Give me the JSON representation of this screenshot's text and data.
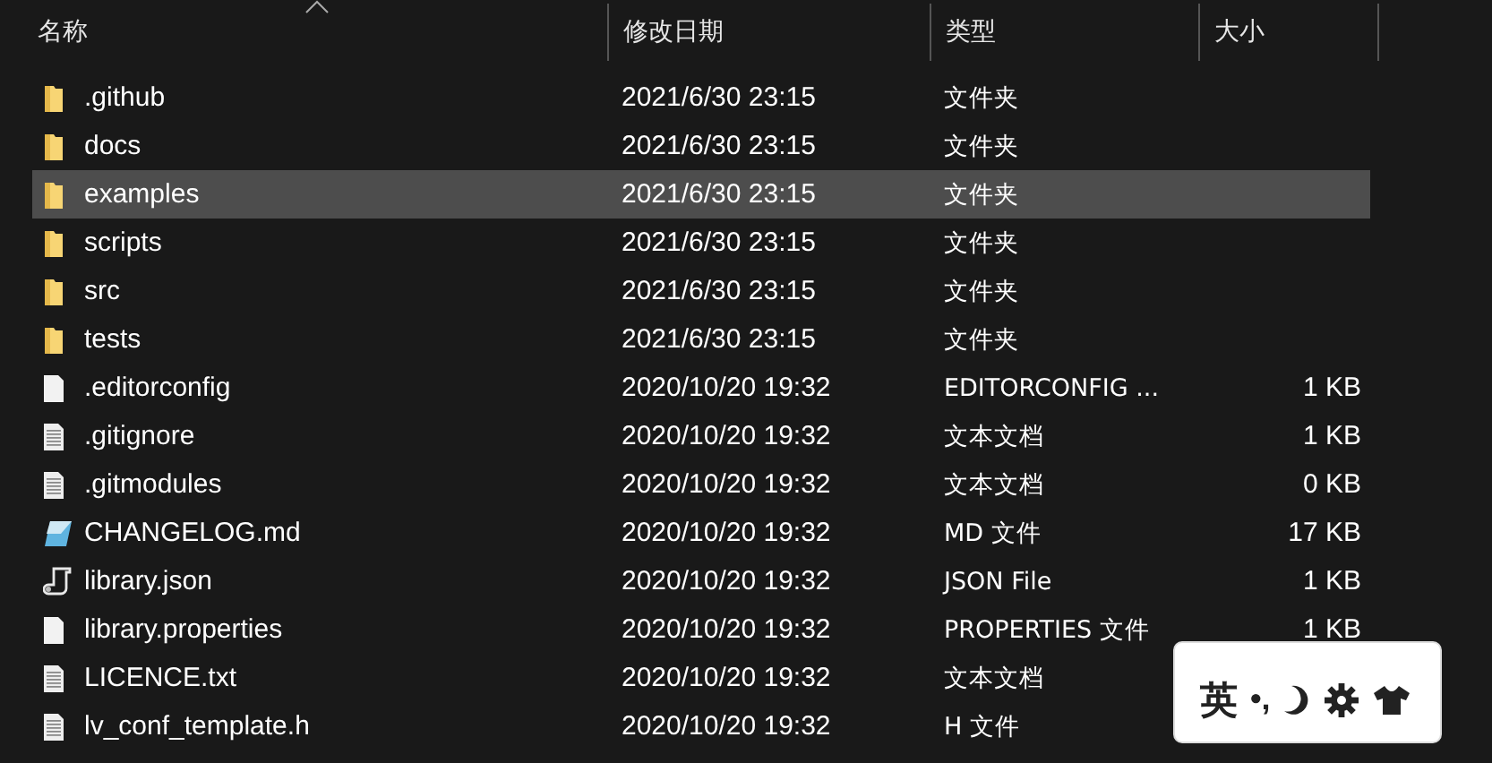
{
  "columns": [
    {
      "label": "名称",
      "sorted": true
    },
    {
      "label": "修改日期",
      "sorted": false
    },
    {
      "label": "类型",
      "sorted": false
    },
    {
      "label": "大小",
      "sorted": false
    }
  ],
  "files": [
    {
      "kind": "folder",
      "name": ".github",
      "date": "2021/6/30 23:15",
      "type": "文件夹",
      "selected": false
    },
    {
      "kind": "folder",
      "name": "docs",
      "date": "2021/6/30 23:15",
      "type": "文件夹",
      "selected": false
    },
    {
      "kind": "folder",
      "name": "examples",
      "date": "2021/6/30 23:15",
      "type": "文件夹",
      "selected": true
    },
    {
      "kind": "folder",
      "name": "scripts",
      "date": "2021/6/30 23:15",
      "type": "文件夹",
      "selected": false
    },
    {
      "kind": "folder",
      "name": "src",
      "date": "2021/6/30 23:15",
      "type": "文件夹",
      "selected": false
    },
    {
      "kind": "folder",
      "name": "tests",
      "date": "2021/6/30 23:15",
      "type": "文件夹",
      "selected": false
    },
    {
      "kind": "blank",
      "name": ".editorconfig",
      "date": "2020/10/20 19:32",
      "type": "EDITORCONFIG ...",
      "size": "1 KB",
      "selected": false
    },
    {
      "kind": "text",
      "name": ".gitignore",
      "date": "2020/10/20 19:32",
      "type": "文本文档",
      "size": "1 KB",
      "selected": false
    },
    {
      "kind": "text",
      "name": ".gitmodules",
      "date": "2020/10/20 19:32",
      "type": "文本文档",
      "size": "0 KB",
      "selected": false
    },
    {
      "kind": "markdown",
      "name": "CHANGELOG.md",
      "date": "2020/10/20 19:32",
      "type": "MD 文件",
      "size": "17 KB",
      "selected": false
    },
    {
      "kind": "script",
      "name": "library.json",
      "date": "2020/10/20 19:32",
      "type": "JSON File",
      "size": "1 KB",
      "selected": false
    },
    {
      "kind": "blank",
      "name": "library.properties",
      "date": "2020/10/20 19:32",
      "type": "PROPERTIES 文件",
      "size": "1 KB",
      "selected": false
    },
    {
      "kind": "text",
      "name": "LICENCE.txt",
      "date": "2020/10/20 19:32",
      "type": "文本文档",
      "selected": false
    },
    {
      "kind": "text",
      "name": "lv_conf_template.h",
      "date": "2020/10/20 19:32",
      "type": "H 文件",
      "selected": false
    }
  ],
  "ime_bar": {
    "mode": "英",
    "punctuation": "•,"
  }
}
